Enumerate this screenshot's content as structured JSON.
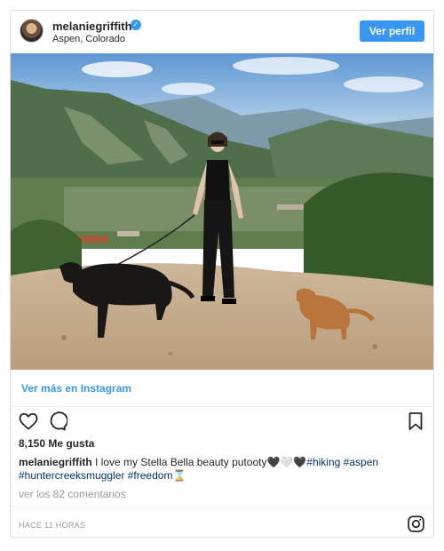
{
  "header": {
    "username": "melaniegriffith",
    "location": "Aspen, Colorado",
    "view_profile_label": "Ver perfil"
  },
  "post": {
    "view_more_label": "Ver más en Instagram",
    "likes": "8,150 Me gusta",
    "caption_user": "melaniegriffith",
    "caption_text": " I love my Stella Bella beauty putooty🖤🤍🖤",
    "hashtags": [
      "#hiking",
      "#aspen",
      "#huntercreeksmuggler",
      "#freedom"
    ],
    "caption_end_emoji": "⌛",
    "comments_label": "ver los 82 comentarios",
    "timestamp": "HACE 11 HORAS"
  },
  "icons": {
    "like": "heart-icon",
    "comment": "comment-icon",
    "save": "bookmark-icon",
    "instagram": "instagram-glyph-icon",
    "verified": "verified-badge-icon"
  },
  "colors": {
    "accent": "#3897f0",
    "hashtag": "#003569",
    "muted": "#999999",
    "border": "#dbdbdb"
  }
}
